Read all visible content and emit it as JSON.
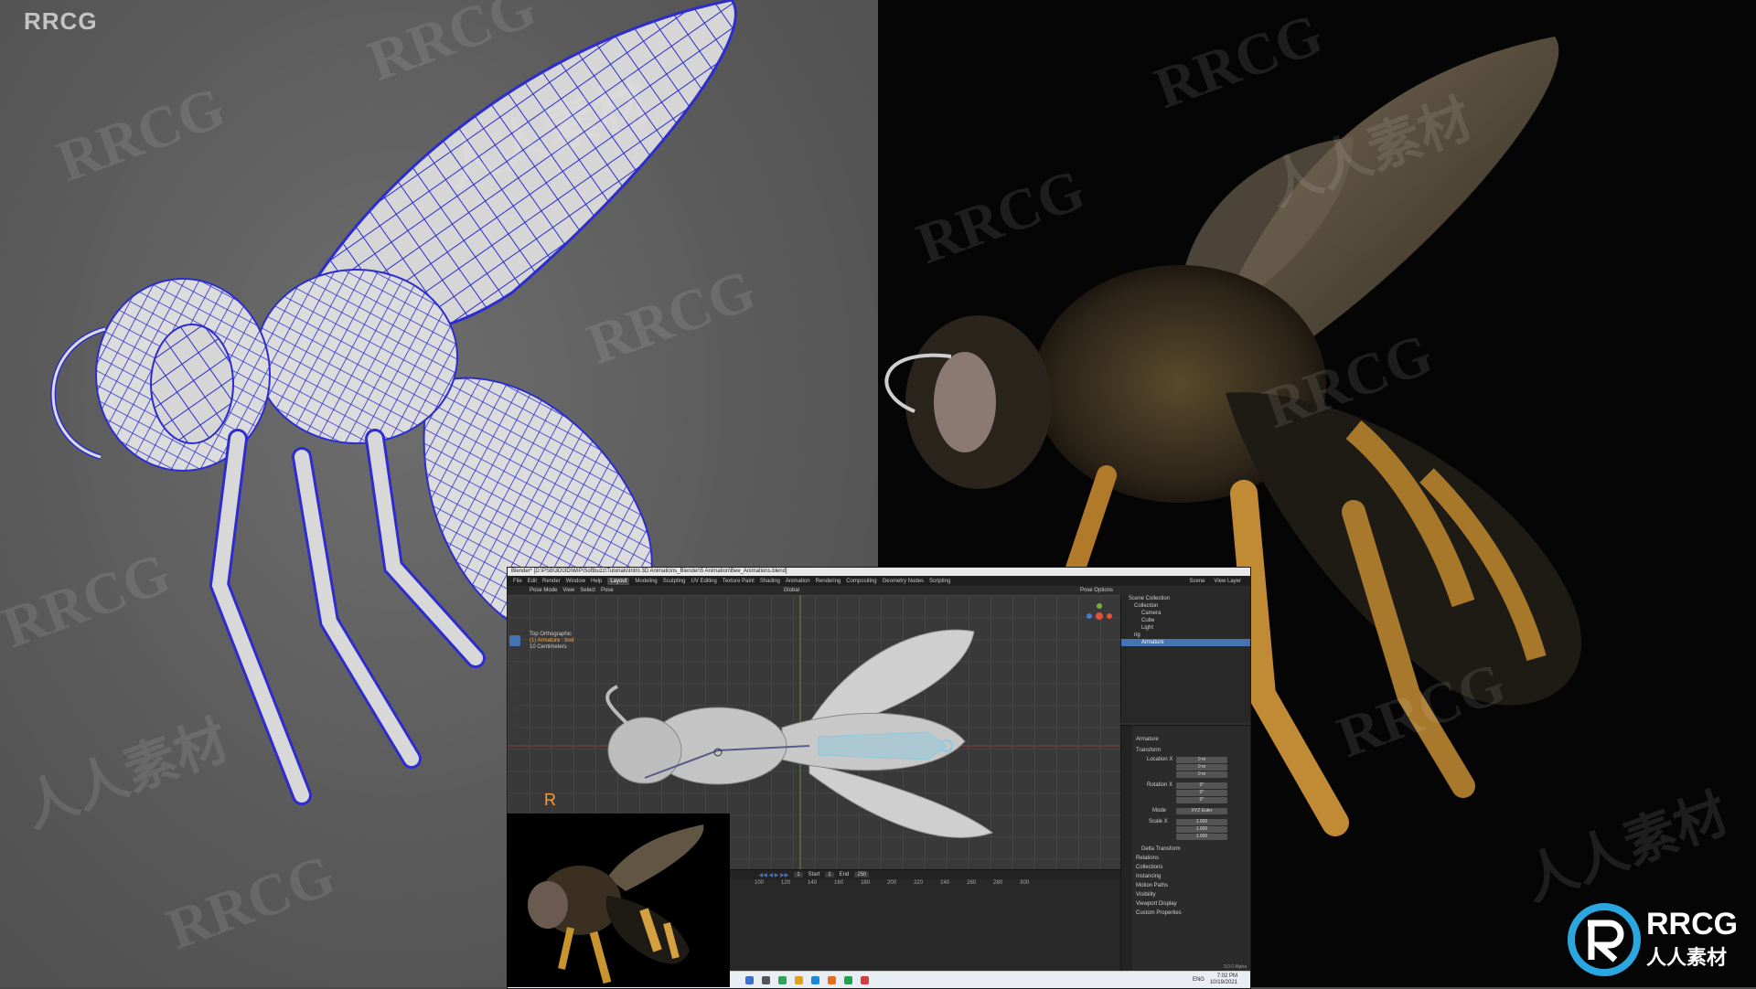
{
  "site_brand": "RRCG",
  "watermarks": [
    "RRCG",
    "人人素材"
  ],
  "colors": {
    "wire": "#2c2ccf",
    "bee_amber": "#c9902f",
    "blender_accent": "#4772b3",
    "selected_text": "#ffaa44"
  },
  "blender": {
    "title": "Blender* [D:\\PSB\\3D\\3D\\WIP\\Softbuzz\\Tutorials\\Intro 3D Animations_Blender\\5 Animation\\Bee_Animations.blend]",
    "menus": [
      "File",
      "Edit",
      "Render",
      "Window",
      "Help"
    ],
    "workspaces": [
      "Layout",
      "Modeling",
      "Sculpting",
      "UV Editing",
      "Texture Paint",
      "Shading",
      "Animation",
      "Rendering",
      "Compositing",
      "Geometry Nodes",
      "Scripting"
    ],
    "active_workspace": "Layout",
    "header": {
      "mode": "Pose Mode",
      "view": "View",
      "select": "Select",
      "pose": "Pose",
      "orientation": "Global",
      "pose_options": "Pose Options"
    },
    "overlay": {
      "view_name": "Top Orthographic",
      "selection": "(1) Armature : bod",
      "units": "10 Centimeters"
    },
    "timeline": {
      "frame_current": "1",
      "start_label": "Start",
      "start": "1",
      "end_label": "End",
      "end": "250",
      "ticks": [
        "100",
        "120",
        "140",
        "160",
        "180",
        "200",
        "220",
        "240",
        "260",
        "280",
        "300"
      ]
    },
    "outliner": {
      "scene": "Scene",
      "view_layer": "View Layer",
      "rows": [
        "Scene Collection",
        "Collection",
        "Camera",
        "Cube",
        "Light",
        "rig",
        "Armature"
      ],
      "active_row": "Armature"
    },
    "properties": {
      "object": "Armature",
      "section": "Transform",
      "location_label": "Location X",
      "location": [
        "0 m",
        "0 m",
        "0 m"
      ],
      "rotation_label": "Rotation X",
      "rotation": [
        "0°",
        "0°",
        "0°"
      ],
      "mode_label": "Mode",
      "mode": "XYZ Euler",
      "scale_label": "Scale X",
      "scale": [
        "1.000",
        "1.000",
        "1.000"
      ],
      "panels": [
        "Delta Transform",
        "Relations",
        "Collections",
        "Instancing",
        "Motion Paths",
        "Visibility",
        "Viewport Display",
        "Custom Properties"
      ]
    },
    "version": "3.0.0 Alpha",
    "clock": {
      "time": "7:02 PM",
      "date": "10/19/2021"
    },
    "lang": "ENG"
  },
  "logo": {
    "en": "RRCG",
    "cn": "人人素材"
  }
}
